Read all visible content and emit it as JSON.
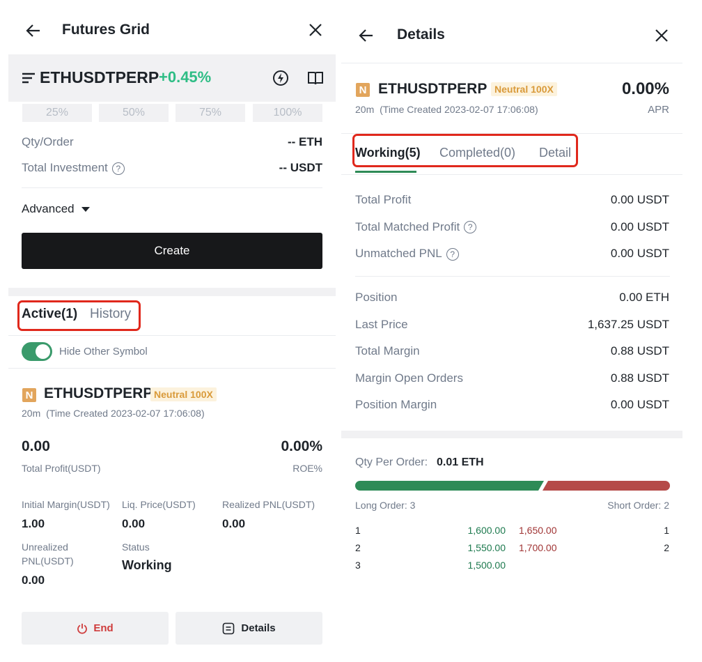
{
  "left": {
    "header": {
      "title": "Futures Grid"
    },
    "symbol_bar": {
      "symbol": "ETHUSDTPERP",
      "change": "+0.45%"
    },
    "percent_buttons": [
      "25%",
      "50%",
      "75%",
      "100%"
    ],
    "qty_order": {
      "label": "Qty/Order",
      "value": "-- ETH"
    },
    "total_investment": {
      "label": "Total Investment",
      "value": "-- USDT"
    },
    "advanced": {
      "label": "Advanced"
    },
    "create_button": "Create",
    "tabs": {
      "active": "Active(1)",
      "history": "History"
    },
    "hide_other": {
      "label": "Hide Other Symbol",
      "on": true
    },
    "card": {
      "badge": "N",
      "symbol": "ETHUSDTPERP",
      "tag": "Neutral 100X",
      "meta_duration": "20m",
      "meta_created": "(Time Created 2023-02-07 17:06:08)",
      "total_profit_value": "0.00",
      "total_profit_label": "Total Profit(USDT)",
      "roe_value": "0.00%",
      "roe_label": "ROE%",
      "initial_margin_label": "Initial Margin(USDT)",
      "initial_margin_value": "1.00",
      "liq_price_label": "Liq. Price(USDT)",
      "liq_price_value": "0.00",
      "realized_pnl_label": "Realized PNL(USDT)",
      "realized_pnl_value": "0.00",
      "unrealized_label_1": "Unrealized",
      "unrealized_label_2": "PNL(USDT)",
      "unrealized_value": "0.00",
      "status_label": "Status",
      "status_value": "Working",
      "end_button": "End",
      "details_button": "Details"
    }
  },
  "right": {
    "header": {
      "title": "Details"
    },
    "symbol": {
      "badge": "N",
      "name": "ETHUSDTPERP",
      "tag": "Neutral 100X",
      "meta_duration": "20m",
      "meta_created": "(Time Created 2023-02-07 17:06:08)",
      "apr_value": "0.00%",
      "apr_label": "APR"
    },
    "tabs": {
      "working": "Working(5)",
      "completed": "Completed(0)",
      "detail": "Detail"
    },
    "profit_rows": [
      {
        "label": "Total Profit",
        "value": "0.00 USDT",
        "help": false
      },
      {
        "label": "Total Matched Profit",
        "value": "0.00 USDT",
        "help": true
      },
      {
        "label": "Unmatched PNL",
        "value": "0.00 USDT",
        "help": true
      }
    ],
    "position_rows": [
      {
        "label": "Position",
        "value": "0.00 ETH"
      },
      {
        "label": "Last Price",
        "value": "1,637.25 USDT"
      },
      {
        "label": "Total Margin",
        "value": "0.88 USDT"
      },
      {
        "label": "Margin Open Orders",
        "value": "0.88 USDT"
      },
      {
        "label": "Position Margin",
        "value": "0.00 USDT"
      }
    ],
    "qty_per_order": {
      "label": "Qty Per Order:",
      "value": "0.01 ETH"
    },
    "order_ratio": {
      "long_fraction": 0.6,
      "long_color": "#2e8b57",
      "short_color": "#b54a48"
    },
    "long_order_label": "Long Order: 3",
    "short_order_label": "Short Order: 2",
    "orders": [
      {
        "idx": "1",
        "long": "1,600.00",
        "short": "1,650.00",
        "sidx": "1"
      },
      {
        "idx": "2",
        "long": "1,550.00",
        "short": "1,700.00",
        "sidx": "2"
      },
      {
        "idx": "3",
        "long": "1,500.00",
        "short": "",
        "sidx": ""
      }
    ]
  },
  "colors": {
    "green": "#2ebd85",
    "highlight_box": "#e0281c",
    "badge": "#e2a55c"
  }
}
